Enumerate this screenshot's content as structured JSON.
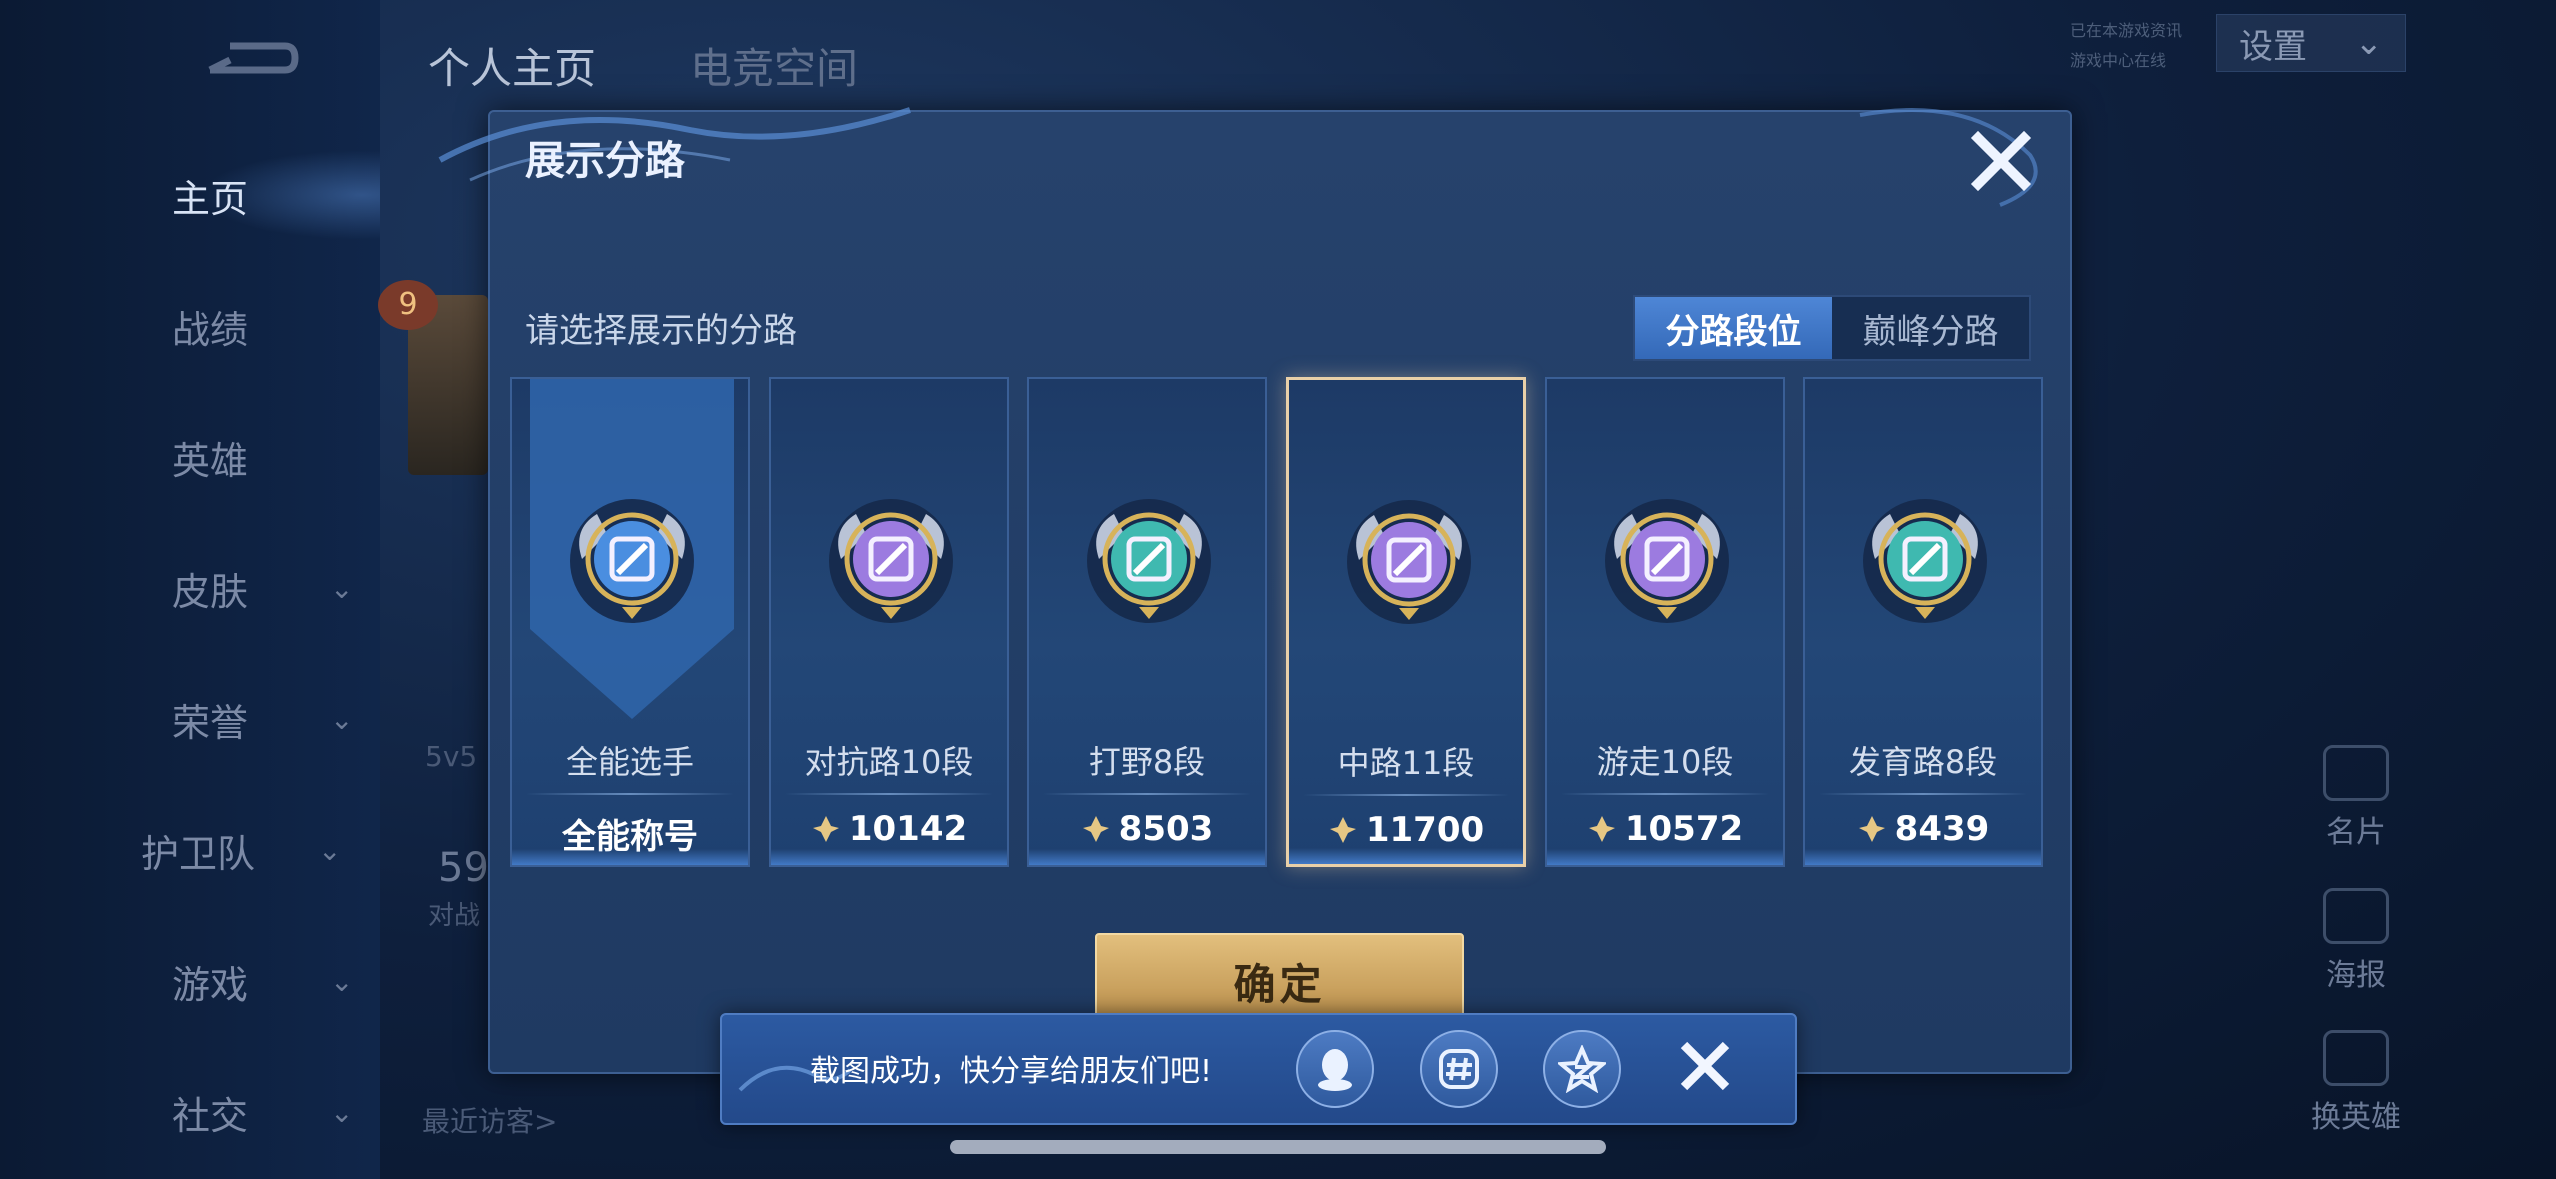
{
  "left_nav": {
    "items": [
      {
        "label": "主页",
        "active": true,
        "has_chevron": false
      },
      {
        "label": "战绩",
        "active": false,
        "has_chevron": false
      },
      {
        "label": "英雄",
        "active": false,
        "has_chevron": false
      },
      {
        "label": "皮肤",
        "active": false,
        "has_chevron": true
      },
      {
        "label": "荣誉",
        "active": false,
        "has_chevron": true
      },
      {
        "label": "护卫队",
        "active": false,
        "has_chevron": true
      },
      {
        "label": "游戏",
        "active": false,
        "has_chevron": true
      },
      {
        "label": "社交",
        "active": false,
        "has_chevron": true
      }
    ]
  },
  "top_bar": {
    "tabs": [
      "个人主页",
      "电竞空间"
    ],
    "settings_label": "设置",
    "status_line1": "已在本游戏资讯",
    "status_line2": "游戏中心在线"
  },
  "background": {
    "badge_number": "9",
    "mode_text": "5v5",
    "count_text": "59",
    "battle_text": "对战",
    "recent_visitors": "最近访客>"
  },
  "right_side": {
    "items": [
      "名片",
      "海报",
      "换英雄"
    ]
  },
  "dialog": {
    "title": "展示分路",
    "subtitle": "请选择展示的分路",
    "toggle": {
      "options": [
        "分路段位",
        "巅峰分路"
      ],
      "selected": 0
    },
    "cards": [
      {
        "name": "全能选手",
        "value": "全能称号",
        "has_gem": false,
        "selected": false,
        "icon": "all-round-emblem-icon",
        "color": "#4a8ee0"
      },
      {
        "name": "对抗路10段",
        "value": "10142",
        "has_gem": true,
        "selected": false,
        "icon": "clash-lane-emblem-icon",
        "color": "#9c7be0"
      },
      {
        "name": "打野8段",
        "value": "8503",
        "has_gem": true,
        "selected": false,
        "icon": "jungle-emblem-icon",
        "color": "#3fb9b0"
      },
      {
        "name": "中路11段",
        "value": "11700",
        "has_gem": true,
        "selected": true,
        "icon": "mid-lane-emblem-icon",
        "color": "#9c7be0"
      },
      {
        "name": "游走10段",
        "value": "10572",
        "has_gem": true,
        "selected": false,
        "icon": "roam-emblem-icon",
        "color": "#9c7be0"
      },
      {
        "name": "发育路8段",
        "value": "8439",
        "has_gem": true,
        "selected": false,
        "icon": "farm-lane-emblem-icon",
        "color": "#3fb9b0"
      }
    ],
    "confirm_label": "确定"
  },
  "toast": {
    "message": "截图成功，快分享给朋友们吧!",
    "share_targets": [
      "qq-icon",
      "wechat-moments-icon",
      "qzone-icon"
    ]
  },
  "colors": {
    "accent_gold": "#e2bf7d",
    "dialog_bg": "#26426c",
    "selected_border": "#e9d0a8"
  }
}
